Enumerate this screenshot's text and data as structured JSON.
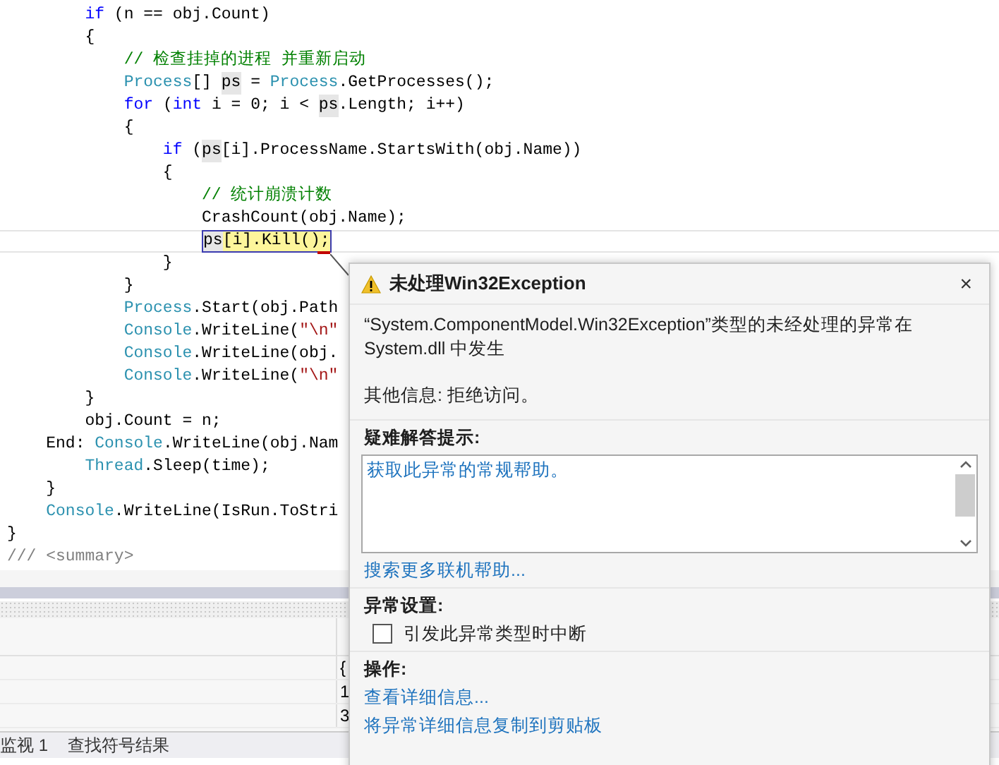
{
  "editor": {
    "lines": [
      {
        "tokens": [
          {
            "kind": "keyword",
            "text": "        if"
          },
          {
            "kind": "plain",
            "text": " (n == obj.Count)"
          }
        ]
      },
      {
        "tokens": [
          {
            "kind": "plain",
            "text": "        {"
          }
        ]
      },
      {
        "tokens": [
          {
            "kind": "comment",
            "text": "            // 检查挂掉的进程 并重新启动"
          }
        ]
      },
      {
        "tokens": [
          {
            "kind": "type",
            "text": "            Process"
          },
          {
            "kind": "plain",
            "text": "[] "
          },
          {
            "kind": "ref",
            "text": "ps"
          },
          {
            "kind": "plain",
            "text": " = "
          },
          {
            "kind": "type",
            "text": "Process"
          },
          {
            "kind": "plain",
            "text": ".GetProcesses();"
          }
        ]
      },
      {
        "tokens": [
          {
            "kind": "keyword",
            "text": "            for"
          },
          {
            "kind": "plain",
            "text": " ("
          },
          {
            "kind": "keyword",
            "text": "int"
          },
          {
            "kind": "plain",
            "text": " i = 0; i < "
          },
          {
            "kind": "ref",
            "text": "ps"
          },
          {
            "kind": "plain",
            "text": ".Length; i++)"
          }
        ]
      },
      {
        "tokens": [
          {
            "kind": "plain",
            "text": "            {"
          }
        ]
      },
      {
        "tokens": [
          {
            "kind": "keyword",
            "text": "                if"
          },
          {
            "kind": "plain",
            "text": " ("
          },
          {
            "kind": "ref",
            "text": "ps"
          },
          {
            "kind": "plain",
            "text": "[i].ProcessName.StartsWith(obj.Name))"
          }
        ]
      },
      {
        "tokens": [
          {
            "kind": "plain",
            "text": "                {"
          }
        ]
      },
      {
        "tokens": [
          {
            "kind": "comment",
            "text": "                    // 统计崩溃计数"
          }
        ]
      },
      {
        "tokens": [
          {
            "kind": "plain",
            "text": "                    CrashCount(obj.Name);"
          }
        ]
      },
      {
        "current": true,
        "tokens": [
          {
            "kind": "ref",
            "text": "                    ps"
          },
          {
            "kind": "plain",
            "text": "[i].Kill();"
          }
        ]
      },
      {
        "tokens": [
          {
            "kind": "plain",
            "text": "                }"
          }
        ]
      },
      {
        "tokens": [
          {
            "kind": "plain",
            "text": "            }"
          }
        ]
      },
      {
        "tokens": [
          {
            "kind": "type",
            "text": "            Process"
          },
          {
            "kind": "plain",
            "text": ".Start(obj.Path"
          }
        ]
      },
      {
        "tokens": [
          {
            "kind": "type",
            "text": "            Console"
          },
          {
            "kind": "plain",
            "text": ".WriteLine("
          },
          {
            "kind": "string",
            "text": "\"\\n\""
          }
        ]
      },
      {
        "tokens": [
          {
            "kind": "type",
            "text": "            Console"
          },
          {
            "kind": "plain",
            "text": ".WriteLine(obj."
          }
        ]
      },
      {
        "tokens": [
          {
            "kind": "type",
            "text": "            Console"
          },
          {
            "kind": "plain",
            "text": ".WriteLine("
          },
          {
            "kind": "string",
            "text": "\"\\n\""
          }
        ]
      },
      {
        "tokens": [
          {
            "kind": "plain",
            "text": "        }"
          }
        ]
      },
      {
        "tokens": [
          {
            "kind": "plain",
            "text": "        obj.Count = n;"
          }
        ]
      },
      {
        "tokens": [
          {
            "kind": "plain",
            "text": "    End: "
          },
          {
            "kind": "type",
            "text": "Console"
          },
          {
            "kind": "plain",
            "text": ".WriteLine(obj.Nam"
          }
        ]
      },
      {
        "tokens": [
          {
            "kind": "type",
            "text": "        Thread"
          },
          {
            "kind": "plain",
            "text": ".Sleep(time);"
          }
        ]
      },
      {
        "tokens": [
          {
            "kind": "plain",
            "text": "    }"
          }
        ]
      },
      {
        "tokens": [
          {
            "kind": "type",
            "text": "    Console"
          },
          {
            "kind": "plain",
            "text": ".WriteLine(IsRun.ToStri"
          }
        ]
      },
      {
        "tokens": [
          {
            "kind": "plain",
            "text": "}"
          }
        ]
      },
      {
        "tokens": [
          {
            "kind": "doc",
            "text": "/// <summary>"
          }
        ]
      }
    ]
  },
  "watch_panel": {
    "rows": [
      {
        "column_2": "{"
      },
      {
        "column_2": "1"
      },
      {
        "column_2": "3"
      }
    ],
    "tabs": [
      {
        "label": "监视 1"
      },
      {
        "label": "查找符号结果"
      }
    ]
  },
  "exception_dialog": {
    "title": "未处理Win32Exception",
    "close_label": "×",
    "message": "“System.ComponentModel.Win32Exception”类型的未经处理的异常在 System.dll 中发生",
    "additional_info": "其他信息: 拒绝访问。",
    "troubleshooting": {
      "heading": "疑难解答提示:",
      "tips": [
        "获取此异常的常规帮助。"
      ]
    },
    "search_link": "搜索更多联机帮助...",
    "exception_settings": {
      "heading": "异常设置:",
      "break_checkbox": {
        "label": "引发此异常类型时中断",
        "checked": false
      }
    },
    "actions": {
      "heading": "操作:",
      "links": [
        "查看详细信息...",
        "将异常详细信息复制到剪贴板"
      ]
    }
  }
}
